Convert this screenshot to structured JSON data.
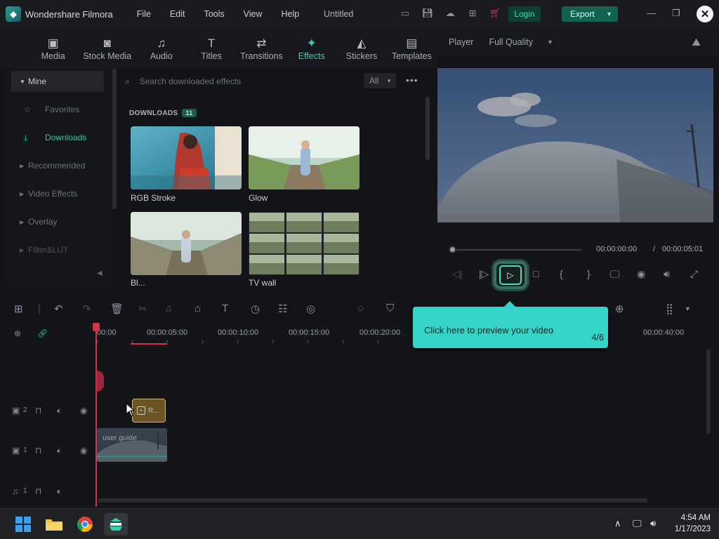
{
  "app": {
    "name": "Wondershare Filmora",
    "doc_title": "Untitled"
  },
  "menu": [
    "File",
    "Edit",
    "Tools",
    "View",
    "Help"
  ],
  "header": {
    "login_label": "Login",
    "export_label": "Export"
  },
  "tabs": [
    {
      "label": "Media",
      "icon": "media-icon"
    },
    {
      "label": "Stock Media",
      "icon": "stock-media-icon"
    },
    {
      "label": "Audio",
      "icon": "music-note-icon"
    },
    {
      "label": "Titles",
      "icon": "text-t-icon"
    },
    {
      "label": "Transitions",
      "icon": "transitions-icon"
    },
    {
      "label": "Effects",
      "icon": "effects-star-icon",
      "active": true
    },
    {
      "label": "Stickers",
      "icon": "sticker-icon"
    },
    {
      "label": "Templates",
      "icon": "templates-icon"
    }
  ],
  "sidebar": {
    "items": [
      {
        "label": "Mine"
      },
      {
        "label": "Favorites"
      },
      {
        "label": "Downloads"
      },
      {
        "label": "Recommended"
      },
      {
        "label": "Video Effects"
      },
      {
        "label": "Overlay"
      },
      {
        "label": "Filter&LUT"
      }
    ]
  },
  "effects": {
    "search_placeholder": "Search downloaded effects",
    "filter_value": "All",
    "section_title": "DOWNLOADS",
    "count": "11",
    "items": [
      {
        "label": "RGB Stroke"
      },
      {
        "label": "Glow"
      },
      {
        "label": "Bl..."
      },
      {
        "label": "TV wall"
      }
    ]
  },
  "player": {
    "label": "Player",
    "quality": "Full Quality",
    "current_time": "00:00:00:00",
    "separator": "/",
    "total_time": "00:00:05:01"
  },
  "timeline": {
    "ruler": [
      "00:00",
      "00:00:05:00",
      "00:00:10:00",
      "00:00:15:00",
      "00:00:20:00",
      "00:00:40:00"
    ],
    "tracks": [
      {
        "num": "2"
      },
      {
        "num": "1"
      },
      {
        "num": "1"
      }
    ],
    "clips": {
      "effect_clip": "R...",
      "video_clip": "user guide"
    }
  },
  "tooltip": {
    "text": "Click here to preview your video",
    "step": "4/6"
  },
  "taskbar": {
    "time": "4:54 AM",
    "date": "1/17/2023"
  },
  "colors": {
    "accent": "#37d0b4",
    "tooltip_bg": "#34d4c8",
    "playhead": "#d6334a",
    "export_bg": "#11624f"
  }
}
